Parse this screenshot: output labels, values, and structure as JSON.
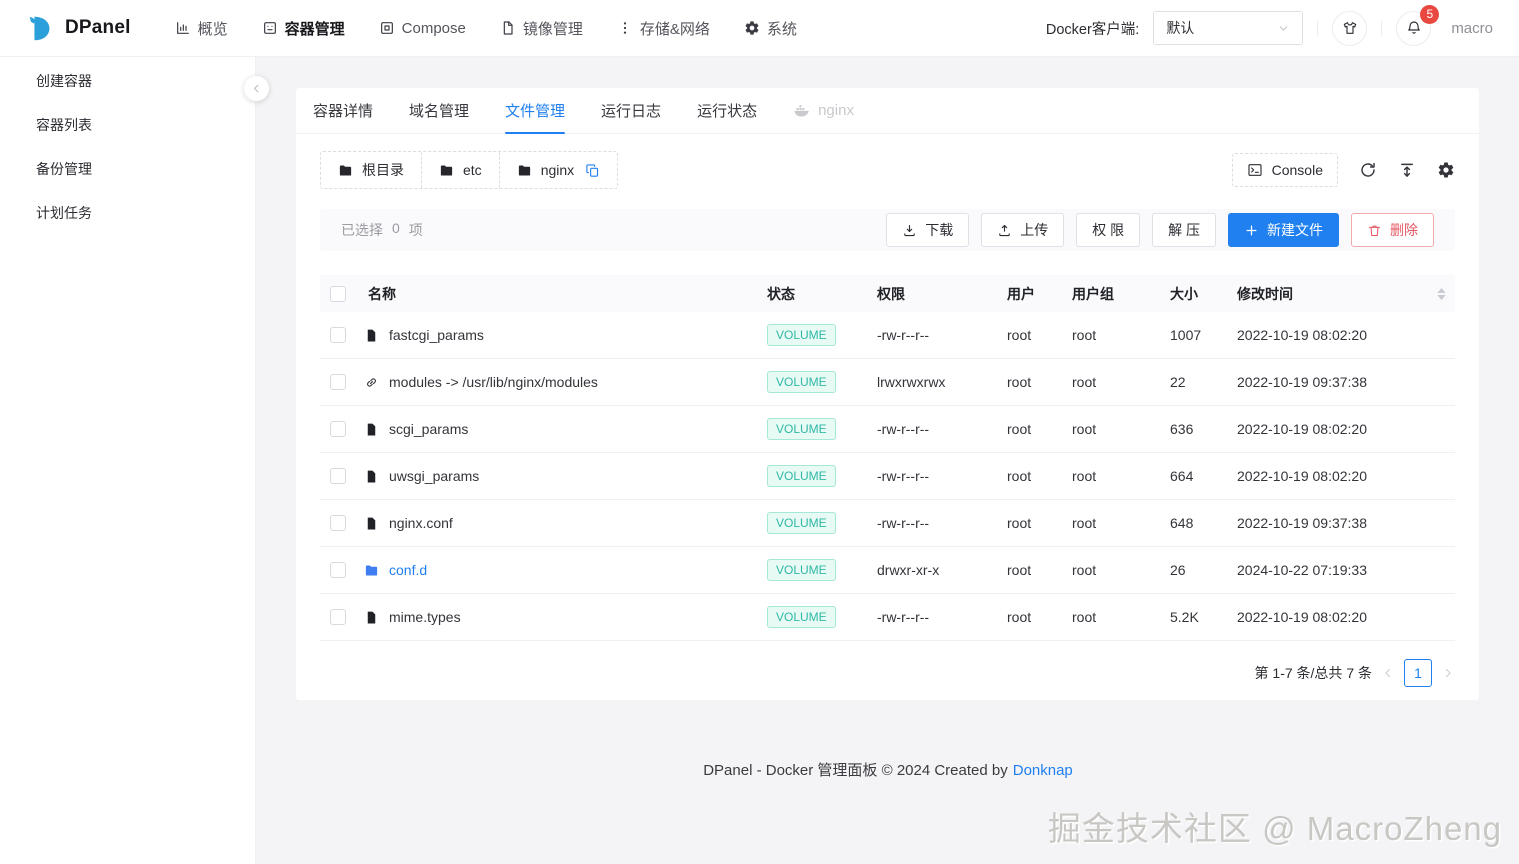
{
  "header": {
    "brand": "DPanel",
    "nav": [
      {
        "label": "概览",
        "icon": "chart-icon",
        "name": "nav-item-overview"
      },
      {
        "label": "容器管理",
        "icon": "container-icon",
        "name": "nav-item-containers",
        "active": true
      },
      {
        "label": "Compose",
        "icon": "compose-icon",
        "name": "nav-item-compose"
      },
      {
        "label": "镜像管理",
        "icon": "image-icon",
        "name": "nav-item-images"
      },
      {
        "label": "存储&网络",
        "icon": "storage-icon",
        "name": "nav-item-storage-network"
      },
      {
        "label": "系统",
        "icon": "system-icon",
        "name": "nav-item-system"
      }
    ],
    "docker_client_label": "Docker客户端:",
    "docker_client_value": "默认",
    "notification_count": "5",
    "username": "macro"
  },
  "sidebar": {
    "items": [
      {
        "label": "创建容器",
        "name": "sidebar-item-create-container"
      },
      {
        "label": "容器列表",
        "name": "sidebar-item-container-list"
      },
      {
        "label": "备份管理",
        "name": "sidebar-item-backup-management"
      },
      {
        "label": "计划任务",
        "name": "sidebar-item-scheduled-tasks"
      }
    ]
  },
  "tabs": [
    {
      "label": "容器详情",
      "name": "tab-container-detail"
    },
    {
      "label": "域名管理",
      "name": "tab-domain-management"
    },
    {
      "label": "文件管理",
      "name": "tab-file-management",
      "active": true
    },
    {
      "label": "运行日志",
      "name": "tab-run-logs"
    },
    {
      "label": "运行状态",
      "name": "tab-run-status"
    },
    {
      "label": "nginx",
      "name": "tab-nginx",
      "icon": "docker-whale-icon",
      "disabled": true
    }
  ],
  "toolbar": {
    "breadcrumbs": [
      {
        "label": "根目录",
        "name": "breadcrumb-root"
      },
      {
        "label": "etc",
        "name": "breadcrumb-etc"
      },
      {
        "label": "nginx",
        "name": "breadcrumb-nginx",
        "copy": true
      }
    ],
    "console_label": "Console"
  },
  "actions": {
    "selected_prefix": "已选择",
    "selected_count": "0",
    "selected_suffix": "项",
    "buttons": [
      {
        "label": "下载",
        "icon": "download-icon",
        "variant": "default",
        "name": "download-button"
      },
      {
        "label": "上传",
        "icon": "upload-icon",
        "variant": "default",
        "name": "upload-button"
      },
      {
        "label": "权 限",
        "variant": "default",
        "name": "permission-button"
      },
      {
        "label": "解 压",
        "variant": "default",
        "name": "unzip-button"
      },
      {
        "label": "新建文件",
        "icon": "plus-icon",
        "variant": "primary",
        "name": "new-file-button"
      },
      {
        "label": "删除",
        "icon": "trash-icon",
        "variant": "danger",
        "name": "delete-button"
      }
    ]
  },
  "table": {
    "columns": [
      "名称",
      "状态",
      "权限",
      "用户",
      "用户组",
      "大小",
      "修改时间"
    ],
    "rows": [
      {
        "name": "fastcgi_params",
        "icon": "file-icon",
        "status": "VOLUME",
        "permission": "-rw-r--r--",
        "user": "root",
        "group": "root",
        "size": "1007",
        "modified": "2022-10-19 08:02:20"
      },
      {
        "name": "modules -> /usr/lib/nginx/modules",
        "icon": "link-icon",
        "status": "VOLUME",
        "permission": "lrwxrwxrwx",
        "user": "root",
        "group": "root",
        "size": "22",
        "modified": "2022-10-19 09:37:38"
      },
      {
        "name": "scgi_params",
        "icon": "file-icon",
        "status": "VOLUME",
        "permission": "-rw-r--r--",
        "user": "root",
        "group": "root",
        "size": "636",
        "modified": "2022-10-19 08:02:20"
      },
      {
        "name": "uwsgi_params",
        "icon": "file-icon",
        "status": "VOLUME",
        "permission": "-rw-r--r--",
        "user": "root",
        "group": "root",
        "size": "664",
        "modified": "2022-10-19 08:02:20"
      },
      {
        "name": "nginx.conf",
        "icon": "file-icon",
        "status": "VOLUME",
        "permission": "-rw-r--r--",
        "user": "root",
        "group": "root",
        "size": "648",
        "modified": "2022-10-19 09:37:38"
      },
      {
        "name": "conf.d",
        "icon": "folder-icon",
        "highlight": true,
        "status": "VOLUME",
        "permission": "drwxr-xr-x",
        "user": "root",
        "group": "root",
        "size": "26",
        "modified": "2024-10-22 07:19:33"
      },
      {
        "name": "mime.types",
        "icon": "file-icon",
        "status": "VOLUME",
        "permission": "-rw-r--r--",
        "user": "root",
        "group": "root",
        "size": "5.2K",
        "modified": "2022-10-19 08:02:20"
      }
    ]
  },
  "pagination": {
    "info": "第 1-7 条/总共 7 条",
    "page": "1"
  },
  "footer": {
    "text": "DPanel - Docker 管理面板 © 2024 Created by",
    "link_label": "Donknap"
  },
  "watermark": {
    "text": "掘金技术社区 @ MacroZheng"
  },
  "colors": {
    "primary": "#2080f0",
    "danger_text": "#e45862",
    "status_badge_text": "#2fb8a5",
    "status_badge_bg": "#e7faf4",
    "status_badge_border": "#a5e8d5",
    "notification_badge": "#e8483f",
    "logo_blue": "#2b9fd9"
  }
}
